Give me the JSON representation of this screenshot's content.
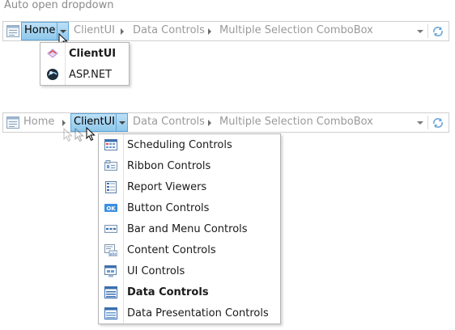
{
  "caption": "Auto open dropdown",
  "bar1": {
    "root_icon": "explorer-page-icon",
    "active": "Home",
    "crumbs": [
      "ClientUI",
      "Data Controls",
      "Multiple Selection ComboBox"
    ],
    "refresh_icon": "refresh-icon"
  },
  "menu1": {
    "items": [
      {
        "label": "ClientUI",
        "icon": "clientui-logo-icon",
        "bold": true
      },
      {
        "label": "ASP.NET",
        "icon": "aspnet-globe-icon",
        "bold": false
      }
    ]
  },
  "bar2": {
    "root_icon": "explorer-page-icon",
    "home": "Home",
    "active": "ClientUI",
    "crumbs": [
      "Data Controls",
      "Multiple Selection ComboBox"
    ],
    "refresh_icon": "refresh-icon"
  },
  "menu2": {
    "items": [
      {
        "label": "Scheduling Controls",
        "icon": "calendar-icon",
        "bold": false
      },
      {
        "label": "Ribbon Controls",
        "icon": "ribbon-icon",
        "bold": false
      },
      {
        "label": "Report Viewers",
        "icon": "report-icon",
        "bold": false
      },
      {
        "label": "Button Controls",
        "icon": "ok-button-icon",
        "bold": false
      },
      {
        "label": "Bar and Menu Controls",
        "icon": "menu-bar-icon",
        "bold": false
      },
      {
        "label": "Content Controls",
        "icon": "content-abc-icon",
        "bold": false
      },
      {
        "label": "UI Controls",
        "icon": "ui-window-icon",
        "bold": false
      },
      {
        "label": "Data Controls",
        "icon": "data-grid-icon",
        "bold": true
      },
      {
        "label": "Data Presentation Controls",
        "icon": "data-presentation-icon",
        "bold": false
      }
    ]
  },
  "colors": {
    "active_bg": "#9fd1f0",
    "active_border": "#5fa7d8",
    "muted_text": "#9a9a9a"
  }
}
